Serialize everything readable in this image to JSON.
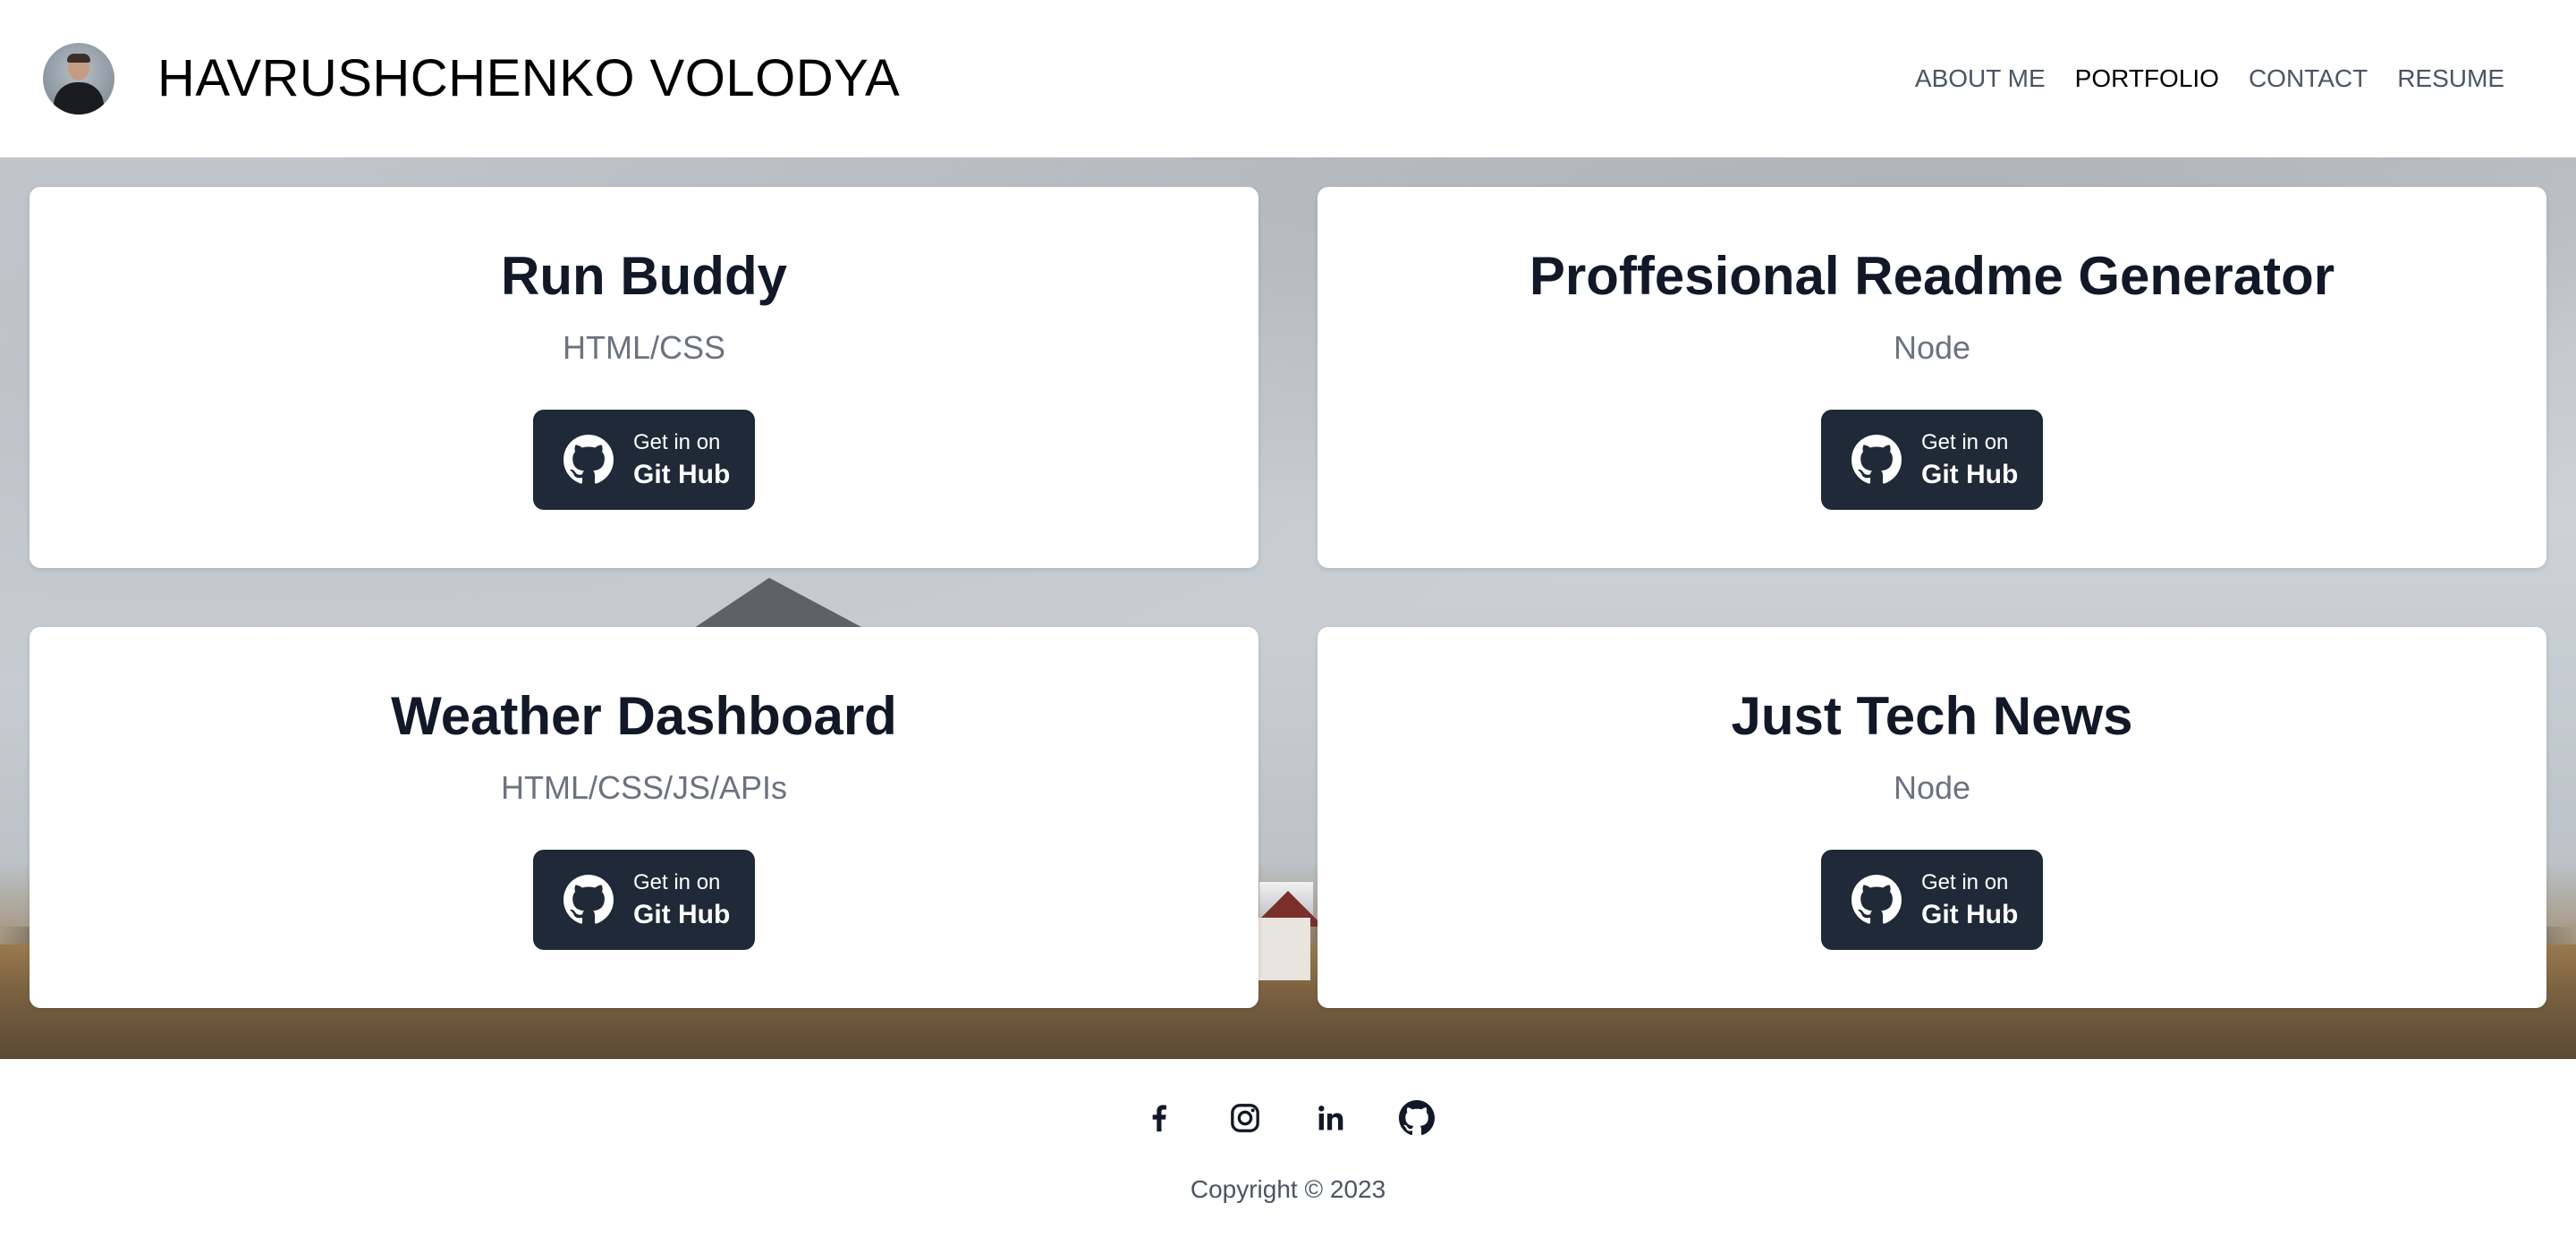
{
  "header": {
    "title": "HAVRUSHCHENKO VOLODYA",
    "nav": [
      {
        "label": "ABOUT ME",
        "active": false
      },
      {
        "label": "PORTFOLIO",
        "active": true
      },
      {
        "label": "CONTACT",
        "active": false
      },
      {
        "label": "RESUME",
        "active": false
      }
    ]
  },
  "projects": [
    {
      "title": "Run Buddy",
      "tech": "HTML/CSS",
      "button_small": "Get in on",
      "button_big": "Git Hub",
      "icon": "github-icon"
    },
    {
      "title": "Proffesional Readme Generator",
      "tech": "Node",
      "button_small": "Get in on",
      "button_big": "Git Hub",
      "icon": "github-icon"
    },
    {
      "title": "Weather Dashboard",
      "tech": "HTML/CSS/JS/APIs",
      "button_small": "Get in on",
      "button_big": "Git Hub",
      "icon": "github-icon"
    },
    {
      "title": "Just Tech News",
      "tech": "Node",
      "button_small": "Get in on",
      "button_big": "Git Hub",
      "icon": "github-icon"
    }
  ],
  "footer": {
    "socials": [
      "facebook-icon",
      "instagram-icon",
      "linkedin-icon",
      "github-icon"
    ],
    "copyright": "Copyright © 2023"
  },
  "colors": {
    "button_bg": "#1f2937",
    "title_text": "#111827",
    "muted_text": "#6b7280",
    "nav_text": "#4b5563"
  }
}
